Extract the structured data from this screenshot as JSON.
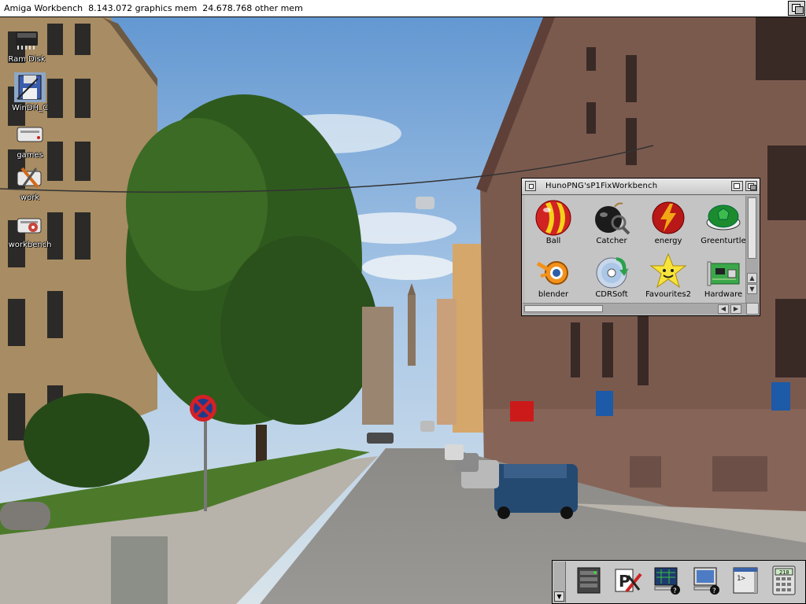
{
  "screen": {
    "title": "Amiga Workbench  8.143.072 graphics mem  24.678.768 other mem"
  },
  "desktop_icons": [
    {
      "label": "Ram Disk",
      "icon": "ram-chip-icon"
    },
    {
      "label": "WinDH_C",
      "icon": "floppy-disk-icon"
    },
    {
      "label": "games",
      "icon": "hard-drive-icon"
    },
    {
      "label": "work",
      "icon": "tools-icon"
    },
    {
      "label": "workbench",
      "icon": "hard-drive-icon"
    }
  ],
  "drawer": {
    "title": "HunoPNG'sP1FixWorkbench",
    "items": [
      {
        "label": "Ball",
        "icon": "ball-icon"
      },
      {
        "label": "Catcher",
        "icon": "bomb-icon"
      },
      {
        "label": "energy",
        "icon": "energy-icon"
      },
      {
        "label": "Greenturtle",
        "icon": "turtle-shell-icon"
      },
      {
        "label": "blender",
        "icon": "blender-icon"
      },
      {
        "label": "CDRSoft",
        "icon": "cd-disc-icon"
      },
      {
        "label": "Favourites2",
        "icon": "star-icon"
      },
      {
        "label": "Hardware",
        "icon": "circuit-board-icon"
      }
    ],
    "vertical_scroll_position": 0.0,
    "horizontal_scroll_position": 0.0
  },
  "dock": {
    "items": [
      {
        "icon": "server-rack-icon",
        "text": ""
      },
      {
        "icon": "preferences-icon",
        "text": ""
      },
      {
        "icon": "help-monitor-icon",
        "text": ""
      },
      {
        "icon": "help-display-icon",
        "text": ""
      },
      {
        "icon": "shell-window-icon",
        "text": "1>"
      },
      {
        "icon": "calculator-icon",
        "text": "218"
      }
    ]
  },
  "colors": {
    "workbench_text": "#ffffff",
    "window_bg": "#bcbcbc",
    "title_bg": "#ffffff"
  }
}
